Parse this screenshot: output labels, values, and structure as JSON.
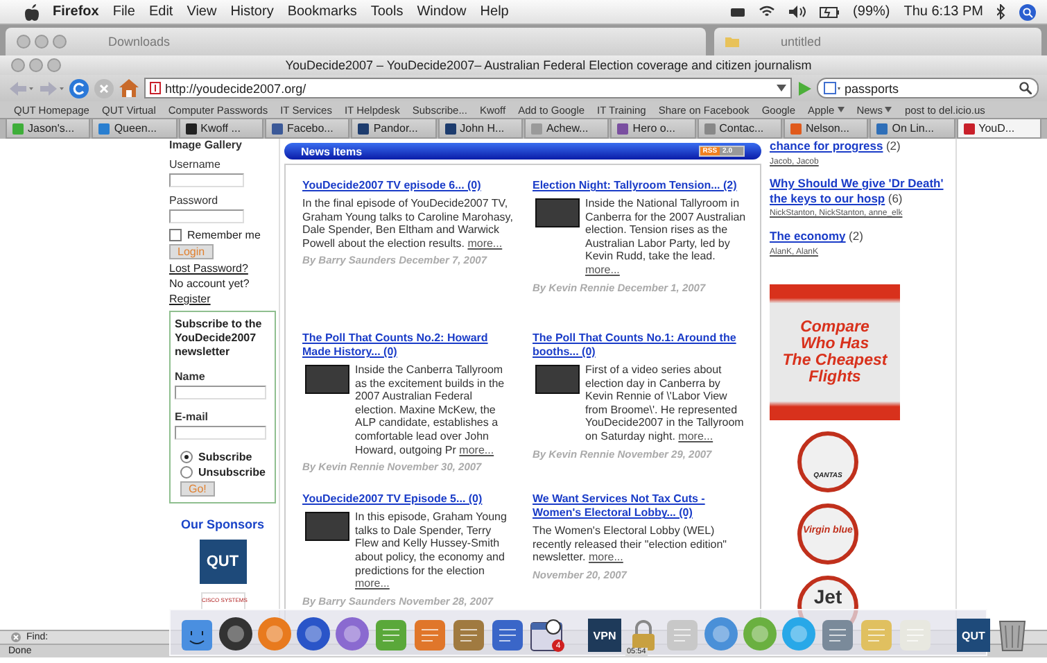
{
  "menubar": {
    "app": "Firefox",
    "menus": [
      "File",
      "Edit",
      "View",
      "History",
      "Bookmarks",
      "Tools",
      "Window",
      "Help"
    ],
    "battery": "(99%)",
    "clock": "Thu 6:13 PM"
  },
  "background_windows": [
    {
      "title": "Downloads"
    },
    {
      "title": "untitled"
    }
  ],
  "window": {
    "title": "YouDecide2007 – YouDecide2007– Australian Federal Election coverage and citizen journalism"
  },
  "toolbar": {
    "url": "http://youdecide2007.org/",
    "search": "passports"
  },
  "bookmarks": [
    {
      "label": "QUT Homepage",
      "menu": false
    },
    {
      "label": "QUT Virtual",
      "menu": false
    },
    {
      "label": "Computer Passwords",
      "menu": false
    },
    {
      "label": "IT Services",
      "menu": false
    },
    {
      "label": "IT Helpdesk",
      "menu": false
    },
    {
      "label": "Subscribe...",
      "menu": false
    },
    {
      "label": "Kwoff",
      "menu": false
    },
    {
      "label": "Add to Google",
      "menu": false
    },
    {
      "label": "IT Training",
      "menu": false
    },
    {
      "label": "Share on Facebook",
      "menu": false
    },
    {
      "label": "Google",
      "menu": false
    },
    {
      "label": "Apple",
      "menu": true
    },
    {
      "label": "News",
      "menu": true
    },
    {
      "label": "post to del.icio.us",
      "menu": false
    }
  ],
  "tabs": [
    {
      "label": "Jason's...",
      "selected": false,
      "color": "#3fae3a"
    },
    {
      "label": "Queen...",
      "selected": false,
      "color": "#2a7fd0"
    },
    {
      "label": "Kwoff ...",
      "selected": false,
      "color": "#222222"
    },
    {
      "label": "Facebo...",
      "selected": false,
      "color": "#3b5998"
    },
    {
      "label": "Pandor...",
      "selected": false,
      "color": "#1d3c6e"
    },
    {
      "label": "John H...",
      "selected": false,
      "color": "#1d3c6e"
    },
    {
      "label": "Achew...",
      "selected": false,
      "color": "#9a9a9a"
    },
    {
      "label": "Hero o...",
      "selected": false,
      "color": "#7a4fa0"
    },
    {
      "label": "Contac...",
      "selected": false,
      "color": "#888888"
    },
    {
      "label": "Nelson...",
      "selected": false,
      "color": "#e05a1c"
    },
    {
      "label": "On Lin...",
      "selected": false,
      "color": "#2f6fb8"
    },
    {
      "label": "YouD...",
      "selected": true,
      "color": "#c8202a"
    }
  ],
  "login": {
    "cut_heading": "Image Gallery",
    "username_label": "Username",
    "password_label": "Password",
    "remember": {
      "label": "Remember me",
      "checked": false
    },
    "button": "Login",
    "lost_password": "Lost Password?",
    "no_account": "No account yet?",
    "register": "Register"
  },
  "newsletter": {
    "title": "Subscribe to the YouDecide2007 newsletter",
    "name_label": "Name",
    "email_label": "E-mail",
    "options": [
      {
        "label": "Subscribe",
        "selected": true
      },
      {
        "label": "Unsubscribe",
        "selected": false
      }
    ],
    "button": "Go!"
  },
  "sponsors": {
    "heading": "Our Sponsors",
    "logos": [
      {
        "kind": "qut",
        "text": "QUT"
      },
      {
        "kind": "cisco",
        "text": "CISCO SYSTEMS"
      }
    ]
  },
  "news": {
    "title": "News Items",
    "feed_badge": [
      "RSS",
      "2.0"
    ],
    "items": [
      {
        "title": "YouDecide2007 TV episode 6... (0)",
        "thumbnail": false,
        "text": "In the final episode of YouDecide2007 TV, Graham Young talks to Caroline Marohasy, Dale Spender, Ben Eltham and Warwick Powell about the election results.",
        "more": "more...",
        "byline": "By Barry Saunders December 7, 2007"
      },
      {
        "title": "Election Night: Tallyroom Tension... (2)",
        "thumbnail": true,
        "text": "Inside the National Tallyroom in Canberra for the 2007 Australian election. Tension rises as the Australian Labor Party, led by Kevin Rudd, take the lead.",
        "more": "more...",
        "byline": "By Kevin Rennie December 1, 2007"
      },
      {
        "title": "The Poll That Counts No.2: Howard Made History... (0)",
        "thumbnail": true,
        "text": "Inside the Canberra Tallyroom as the excitement builds in the 2007 Australian Federal election. Maxine McKew, the ALP candidate, establishes a comfortable lead over John Howard, outgoing Pr",
        "more": "more...",
        "byline": "By Kevin Rennie November 30, 2007"
      },
      {
        "title": "The Poll That Counts No.1: Around the booths... (0)",
        "thumbnail": true,
        "text": "First of a video series about election day in Canberra by Kevin Rennie of \\'Labor View from Broome\\'. He represented YouDecide2007 in the Tallyroom on Saturday night.",
        "more": "more...",
        "byline": "By Kevin Rennie November 29, 2007"
      },
      {
        "title": "YouDecide2007 TV Episode 5... (0)",
        "thumbnail": true,
        "text": "In this episode, Graham Young talks to Dale Spender, Terry Flew and Kelly Hussey-Smith about policy, the economy and predictions for the election",
        "more": "more...",
        "byline": "By Barry Saunders November 28, 2007"
      },
      {
        "title": "We Want Services Not Tax Cuts - Women's Electoral Lobby... (0)",
        "thumbnail": false,
        "text": "The Women's Electoral Lobby (WEL) recently released their \"election edition\" newsletter.",
        "more": "more...",
        "byline": "November 20, 2007"
      }
    ]
  },
  "topics": [
    {
      "title": "chance for progress",
      "count": "(2)",
      "authors": "Jacob, Jacob"
    },
    {
      "title": "Why Should We give 'Dr Death' the keys to our hosp",
      "count": "(6)",
      "authors": "NickStanton, NickStanton, anne_elk"
    },
    {
      "title": "The economy",
      "count": "(2)",
      "authors": "AlanK, AlanK"
    }
  ],
  "ad": {
    "lines": [
      "Compare",
      "Who Has",
      "The Cheapest",
      "Flights"
    ],
    "airlines": [
      {
        "kind": "qantas",
        "text": "QANTAS"
      },
      {
        "kind": "virgin",
        "text": "Virgin blue"
      },
      {
        "kind": "jet",
        "text": "Jet"
      }
    ]
  },
  "find_bar": {
    "label": "Find:"
  },
  "status_bar": {
    "text": "Done"
  },
  "dock": [
    {
      "kind": "face",
      "color": "#4a8fe0"
    },
    {
      "kind": "circle",
      "color": "#333333"
    },
    {
      "kind": "circle",
      "color": "#e87a1e"
    },
    {
      "kind": "circle",
      "color": "#2a55c8"
    },
    {
      "kind": "circle",
      "color": "#8a6ad0"
    },
    {
      "kind": "tile",
      "color": "#5aa83a"
    },
    {
      "kind": "tile",
      "color": "#e0762a"
    },
    {
      "kind": "tile",
      "color": "#a07a40"
    },
    {
      "kind": "tile",
      "color": "#3a66c8"
    },
    {
      "kind": "calendar",
      "color": "#d8d8e8",
      "badge": "4"
    },
    {
      "kind": "label",
      "color": "#1e3a5a",
      "text": "VPN"
    },
    {
      "kind": "lock",
      "color": "#c8a040",
      "caption": "05:54"
    },
    {
      "kind": "tile",
      "color": "#c8c8c8"
    },
    {
      "kind": "circle",
      "color": "#4a90d8"
    },
    {
      "kind": "circle",
      "color": "#6ab040"
    },
    {
      "kind": "circle",
      "color": "#28a8e8"
    },
    {
      "kind": "tile",
      "color": "#7a8a9a"
    },
    {
      "kind": "tile",
      "color": "#e0c060"
    },
    {
      "kind": "tile",
      "color": "#e8e8e0"
    },
    {
      "kind": "label",
      "color": "#1e4a7a",
      "text": "QUT"
    },
    {
      "kind": "trash",
      "color": "#a8a8a8"
    }
  ]
}
